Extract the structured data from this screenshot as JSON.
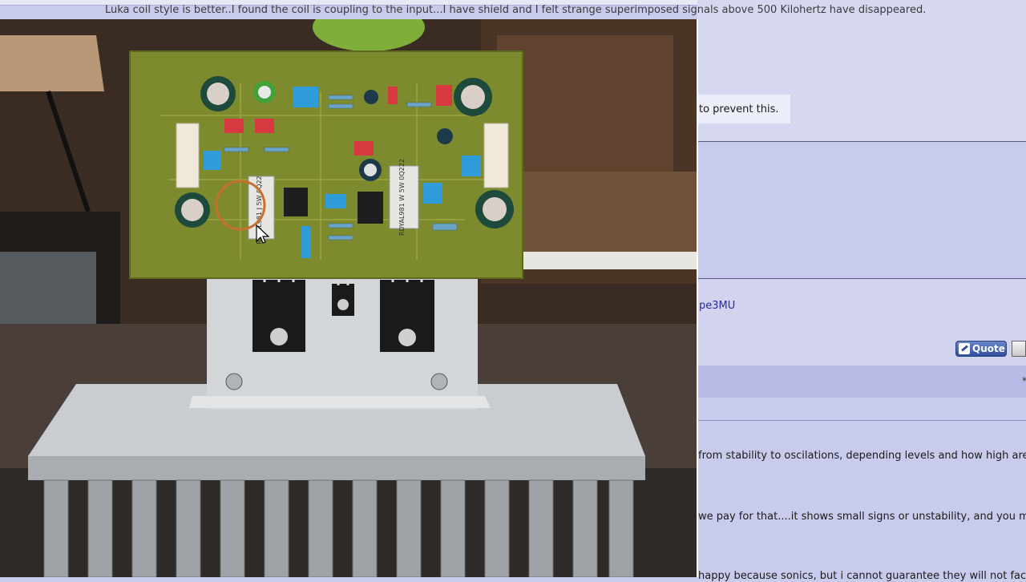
{
  "post_lines": {
    "line1": "Luka coil style is better..I found the coil is coupling to the input...I have shield and I felt strange superimposed signals above 500 Kilohertz have disappeared.",
    "line2": "to prevent this.",
    "line3": "pe3MU",
    "line4": "from stability to oscilations, depending levels and how high are t",
    "line5": " we pay for that....it shows small signs or unstability, and you m",
    "line6": "happy because sonics, but i cannot guarantee they will not face"
  },
  "buttons": {
    "quote_label": "Quote"
  },
  "marks": {
    "star": "*"
  },
  "photo": {
    "transistor_label_left": "RDYAL981 J 5W 0Q22",
    "transistor_label_right": "RDYAL981 W 5W 0Q222"
  },
  "colors": {
    "forum_bg": "#c9cbec",
    "forum_band": "#d6d8f1",
    "pcb_green": "#7d8a2e",
    "heatsink": "#b9bdc2"
  }
}
